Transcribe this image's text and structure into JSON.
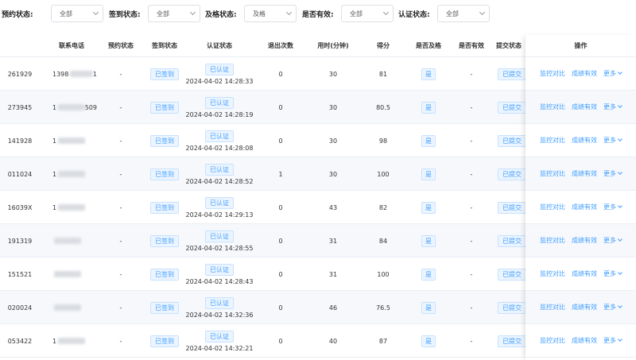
{
  "filters": [
    {
      "label": "预约状态:",
      "value": "全部"
    },
    {
      "label": "签到状态:",
      "value": "全部"
    },
    {
      "label": "及格状态:",
      "value": "及格"
    },
    {
      "label": "是否有效:",
      "value": "全部"
    },
    {
      "label": "认证状态:",
      "value": "全部"
    }
  ],
  "columns": [
    "联系电话",
    "预约状态",
    "签到状态",
    "认证状态",
    "退出次数",
    "用时(分钟)",
    "得分",
    "是否及格",
    "是否有效",
    "提交状态",
    "操作"
  ],
  "actions": {
    "monitor": "监控对比",
    "valid": "成绩有效",
    "more": "更多"
  },
  "rows": [
    {
      "id": "261929",
      "phone": "1398",
      "phone_tail": "1",
      "reserve": "-",
      "checkin": "已签到",
      "auth": "已认证",
      "time": "2024-04-02 14:28:33",
      "exits": "0",
      "duration": "30",
      "score": "81",
      "pass": "是",
      "valid": "-",
      "submit": "已提交"
    },
    {
      "id": "273945",
      "phone": "1",
      "phone_tail": "509",
      "reserve": "-",
      "checkin": "已签到",
      "auth": "已认证",
      "time": "2024-04-02 14:28:19",
      "exits": "0",
      "duration": "30",
      "score": "80.5",
      "pass": "是",
      "valid": "-",
      "submit": "已提交"
    },
    {
      "id": "141928",
      "phone": "1",
      "phone_tail": "",
      "reserve": "-",
      "checkin": "已签到",
      "auth": "已认证",
      "time": "2024-04-02 14:28:08",
      "exits": "0",
      "duration": "30",
      "score": "98",
      "pass": "是",
      "valid": "-",
      "submit": "已提交"
    },
    {
      "id": "011024",
      "phone": "1",
      "phone_tail": "",
      "reserve": "-",
      "checkin": "已签到",
      "auth": "已认证",
      "time": "2024-04-02 14:28:52",
      "exits": "1",
      "duration": "30",
      "score": "100",
      "pass": "是",
      "valid": "-",
      "submit": "已提交"
    },
    {
      "id": "16039X",
      "phone": "1",
      "phone_tail": "",
      "reserve": "-",
      "checkin": "已签到",
      "auth": "已认证",
      "time": "2024-04-02 14:29:13",
      "exits": "0",
      "duration": "43",
      "score": "82",
      "pass": "是",
      "valid": "-",
      "submit": "已提交"
    },
    {
      "id": "191319",
      "phone": "",
      "phone_tail": "",
      "reserve": "-",
      "checkin": "已签到",
      "auth": "已认证",
      "time": "2024-04-02 14:28:55",
      "exits": "0",
      "duration": "31",
      "score": "84",
      "pass": "是",
      "valid": "-",
      "submit": "已提交"
    },
    {
      "id": "151521",
      "phone": "",
      "phone_tail": "",
      "reserve": "-",
      "checkin": "已签到",
      "auth": "已认证",
      "time": "2024-04-02 14:28:43",
      "exits": "0",
      "duration": "31",
      "score": "100",
      "pass": "是",
      "valid": "-",
      "submit": "已提交"
    },
    {
      "id": "020024",
      "phone": "",
      "phone_tail": "",
      "reserve": "-",
      "checkin": "已签到",
      "auth": "已认证",
      "time": "2024-04-02 14:32:36",
      "exits": "0",
      "duration": "46",
      "score": "76.5",
      "pass": "是",
      "valid": "-",
      "submit": "已提交"
    },
    {
      "id": "053422",
      "phone": "1",
      "phone_tail": "",
      "reserve": "-",
      "checkin": "已签到",
      "auth": "已认证",
      "time": "2024-04-02 14:32:21",
      "exits": "0",
      "duration": "40",
      "score": "87",
      "pass": "是",
      "valid": "-",
      "submit": "已提交"
    }
  ],
  "colors": {
    "accent": "#409eff",
    "tag_bg": "#ecf5ff",
    "tag_border": "#c6e2ff",
    "row_alt": "#f6f8fb",
    "border": "#ebeef5"
  }
}
